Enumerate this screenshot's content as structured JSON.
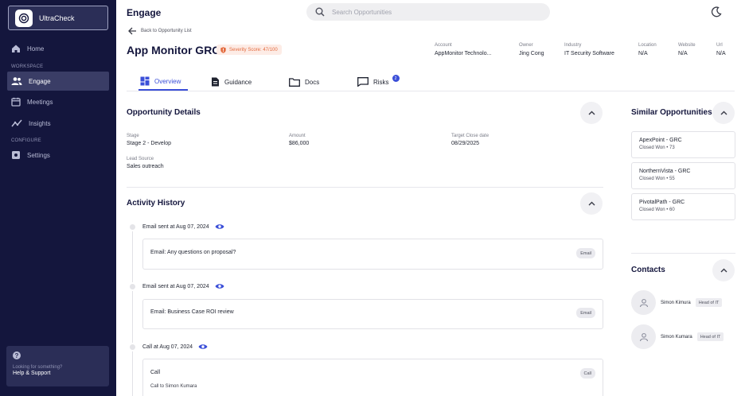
{
  "brand": {
    "name": "UltraCheck"
  },
  "sidebar": {
    "home": "Home",
    "workspace_label": "WORKSPACE",
    "engage": "Engage",
    "meetings": "Meetings",
    "insights": "Insights",
    "configure_label": "CONFIGURE",
    "settings": "Settings",
    "help_sub": "Looking for something?",
    "help_main": "Help & Support"
  },
  "header": {
    "title": "Engage",
    "search_placeholder": "Search Opportunities"
  },
  "opportunity": {
    "back_label": "Back to Opportunity List",
    "title": "App Monitor GRC",
    "severity": "Severity Score: 47/100",
    "meta": {
      "account_label": "Account",
      "account_value": "AppMonitor Technolo...",
      "owner_label": "Owner",
      "owner_value": "Jing Cong",
      "industry_label": "Industry",
      "industry_value": "IT Security Software",
      "location_label": "Location",
      "location_value": "N/A",
      "website_label": "Website",
      "website_value": "N/A",
      "url_label": "Url",
      "url_value": "N/A"
    }
  },
  "tabs": {
    "overview": "Overview",
    "guidance": "Guidance",
    "docs": "Docs",
    "risks": "Risks",
    "risks_count": "2"
  },
  "details": {
    "title": "Opportunity Details",
    "stage_label": "Stage",
    "stage_value": "Stage 2 - Develop",
    "amount_label": "Amount",
    "amount_value": "$86,000",
    "close_label": "Target Close date",
    "close_value": "08/29/2025",
    "lead_label": "Lead Source",
    "lead_value": "Sales outreach"
  },
  "activity": {
    "title": "Activity History",
    "items": [
      {
        "head": "Email sent at Aug 07, 2024",
        "title": "Email: Any questions on proposal?",
        "chip": "Email",
        "sub": ""
      },
      {
        "head": "Email sent at Aug 07, 2024",
        "title": "Email: Business Case ROI review",
        "chip": "Email",
        "sub": ""
      },
      {
        "head": "Call at Aug 07, 2024",
        "title": "Call",
        "chip": "Call",
        "sub": "Call to Simon Kumara"
      }
    ]
  },
  "similar": {
    "title": "Similar Opportunities",
    "items": [
      {
        "name": "ApexPoint - GRC",
        "sub": "Closed Won  •  73"
      },
      {
        "name": "NorthernVista - GRC",
        "sub": "Closed Won  •  55"
      },
      {
        "name": "PivotalPath - GRC",
        "sub": "Closed Won  •  60"
      }
    ]
  },
  "contacts": {
    "title": "Contacts",
    "items": [
      {
        "name": "Simon Kimura",
        "role": "Head of IT"
      },
      {
        "name": "Simon Kumara",
        "role": "Head of IT"
      }
    ]
  },
  "colors": {
    "sidebar": "#14163d",
    "accent": "#3b4fd8",
    "severity": "#e36b3f"
  }
}
